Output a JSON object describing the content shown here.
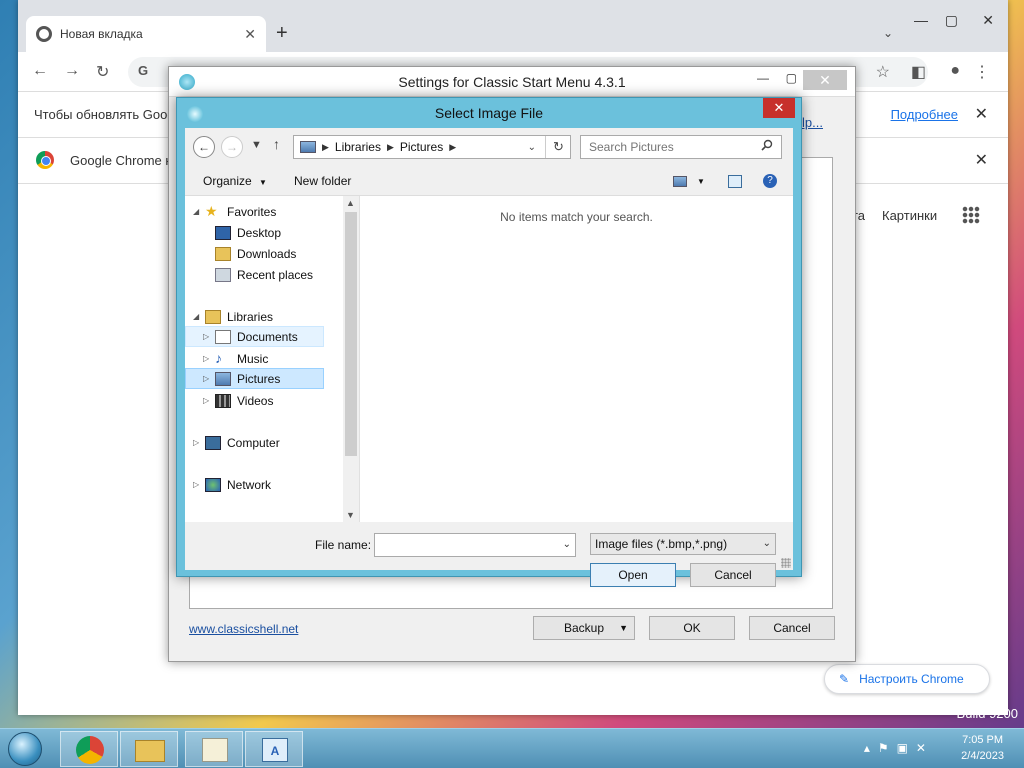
{
  "browser": {
    "tab_title": "Новая вкладка",
    "new_tab": "+",
    "omnibox_letter": "G",
    "infobar_text": "Чтобы обновлять Goog",
    "infobar_more": "Подробнее",
    "infobar2_text": "Google Chrome н",
    "google_links": [
      "та",
      "Картинки"
    ],
    "customize": "Настроить Chrome"
  },
  "settings": {
    "title": "Settings for Classic Start Menu 4.3.1",
    "help_link": "elp...",
    "website": "www.classicshell.net",
    "backup": "Backup",
    "ok": "OK",
    "cancel": "Cancel"
  },
  "dialog": {
    "title": "Select Image File",
    "breadcrumbs": [
      "Libraries",
      "Pictures"
    ],
    "search_placeholder": "Search Pictures",
    "organize": "Organize",
    "new_folder": "New folder",
    "empty_message": "No items match your search.",
    "tree": {
      "favorites": "Favorites",
      "desktop": "Desktop",
      "downloads": "Downloads",
      "recent": "Recent places",
      "libraries": "Libraries",
      "documents": "Documents",
      "music": "Music",
      "pictures": "Pictures",
      "videos": "Videos",
      "computer": "Computer",
      "network": "Network"
    },
    "file_name_label": "File name:",
    "file_name_value": "",
    "file_type": "Image files (*.bmp,*.png)",
    "open": "Open",
    "cancel": "Cancel"
  },
  "taskbar": {
    "time": "7:05 PM",
    "date": "2/4/2023",
    "build": "Build 9200"
  }
}
